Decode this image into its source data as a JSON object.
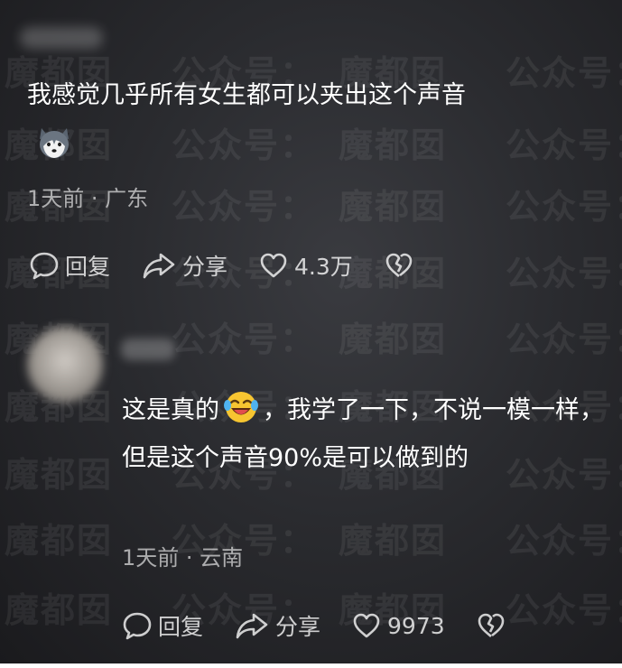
{
  "watermark": {
    "text_a": "魔都囡",
    "text_b": "公众号："
  },
  "comment": {
    "text": "我感觉几乎所有女生都可以夹出这个声音",
    "emoji_icon": "husky-dog-emoji",
    "meta": "1天前 · 广东",
    "actions": {
      "reply_label": "回复",
      "share_label": "分享",
      "like_count": "4.3万"
    }
  },
  "reply": {
    "text_part1": "这是真的",
    "emoji_icon": "laughing-tears-emoji",
    "text_part2": "，我学了一下，不说一模一样，但是这个声音90%是可以做到的",
    "meta": "1天前 · 云南",
    "actions": {
      "reply_label": "回复",
      "share_label": "分享",
      "like_count": "9973"
    }
  }
}
